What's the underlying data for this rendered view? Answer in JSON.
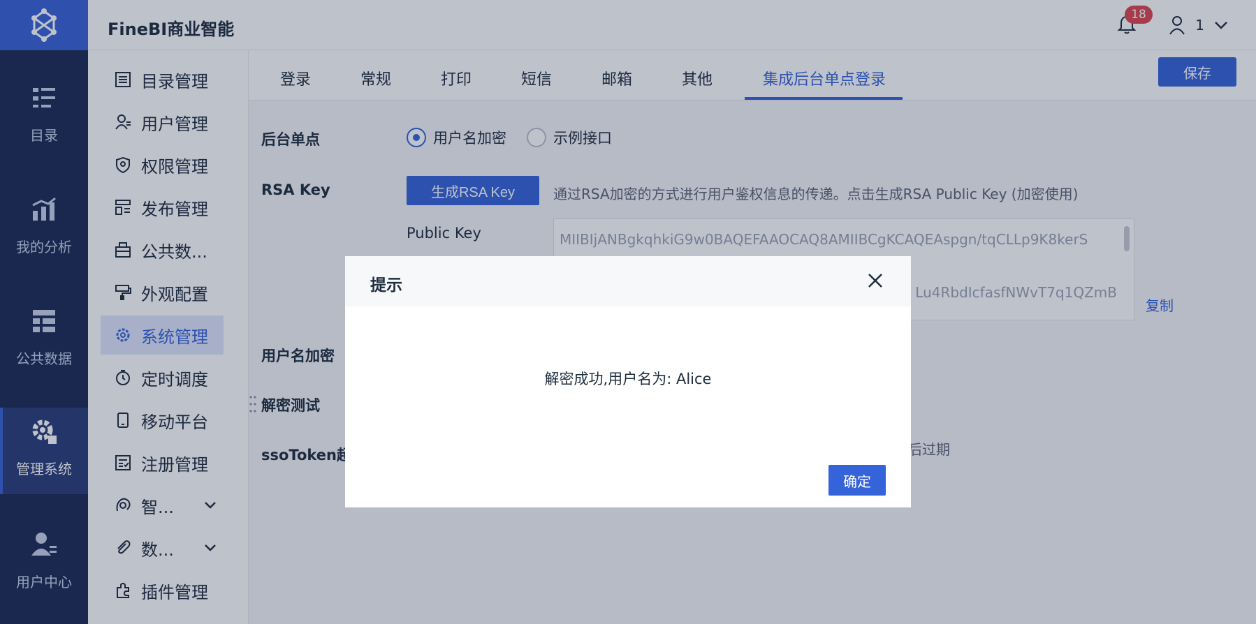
{
  "rail": {
    "items": [
      {
        "label": "目录",
        "icon": "catalog-icon"
      },
      {
        "label": "我的分析",
        "icon": "analysis-icon"
      },
      {
        "label": "公共数据",
        "icon": "public-data-icon"
      },
      {
        "label": "管理系统",
        "icon": "settings-icon",
        "active": true
      },
      {
        "label": "用户中心",
        "icon": "user-center-icon"
      }
    ]
  },
  "header": {
    "brand": "FineBI商业智能",
    "notification_count": "18",
    "user_name": "1"
  },
  "subnav": {
    "items": [
      {
        "label": "目录管理",
        "icon": "list-icon"
      },
      {
        "label": "用户管理",
        "icon": "user-icon"
      },
      {
        "label": "权限管理",
        "icon": "shield-icon"
      },
      {
        "label": "发布管理",
        "icon": "publish-icon"
      },
      {
        "label": "公共数...",
        "icon": "database-icon"
      },
      {
        "label": "外观配置",
        "icon": "paint-icon"
      },
      {
        "label": "系统管理",
        "icon": "gear-icon",
        "active": true
      },
      {
        "label": "定时调度",
        "icon": "timer-icon"
      },
      {
        "label": "移动平台",
        "icon": "mobile-icon"
      },
      {
        "label": "注册管理",
        "icon": "register-icon"
      },
      {
        "label": "智...",
        "icon": "intelligence-icon",
        "expandable": true
      },
      {
        "label": "数...",
        "icon": "attachment-icon",
        "expandable": true
      },
      {
        "label": "插件管理",
        "icon": "plugin-icon"
      }
    ]
  },
  "tabs": [
    "登录",
    "常规",
    "打印",
    "短信",
    "邮箱",
    "其他",
    "集成后台单点登录"
  ],
  "active_tab": "集成后台单点登录",
  "toolbar": {
    "save_label": "保存"
  },
  "form": {
    "sso_label": "后台单点",
    "radio_options": [
      "用户名加密",
      "示例接口"
    ],
    "radio_selected": "用户名加密",
    "rsa_label": "RSA Key",
    "generate_button": "生成RSA Key",
    "rsa_hint": "通过RSA加密的方式进行用户鉴权信息的传递。点击生成RSA Public Key (加密使用)",
    "public_key_label": "Public Key",
    "public_key_line1": "MIIBIjANBgkqhkiG9w0BAQEFAAOCAQ8AMIIBCgKCAQEAspgn/tqCLLp9K8kerS",
    "public_key_line3": "Lu4RbdIcfasfNWvT7q1QZmB",
    "copy_label": "复制",
    "username_encrypt_label": "用户名加密",
    "decrypt_test_label": "解密测试",
    "sso_token_label": "ssoToken超",
    "expire_text": "后过期"
  },
  "modal": {
    "title": "提示",
    "message": "解密成功,用户名为: Alice",
    "ok_label": "确定"
  }
}
